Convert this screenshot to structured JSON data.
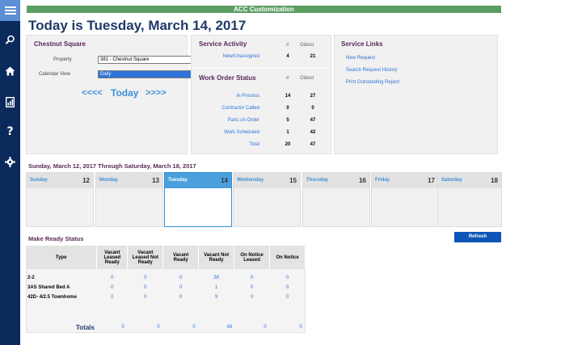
{
  "app": {
    "banner": "ACC Customization"
  },
  "page": {
    "title": "Today is Tuesday, March 14, 2017"
  },
  "sidebar": {
    "icons": [
      "menu-icon",
      "search-icon",
      "home-icon",
      "report-icon",
      "help-icon",
      "settings-icon"
    ]
  },
  "property_panel": {
    "title": "Chestnut Square",
    "property_label": "Property",
    "property_value": "381 - Chestnut Square",
    "calendar_label": "Calendar View",
    "calendar_value": "Daily",
    "prev": "<<<<",
    "today": "Today",
    "next": ">>>>"
  },
  "service_activity": {
    "title": "Service Activity",
    "col_count": "#",
    "col_oldest": "Oldest",
    "rows": [
      {
        "label": "New/Unassigned",
        "count": "4",
        "oldest": "21"
      }
    ]
  },
  "work_order_status": {
    "title": "Work Order Status",
    "col_count": "#",
    "col_oldest": "Oldest",
    "rows": [
      {
        "label": "In Process",
        "count": "14",
        "oldest": "27"
      },
      {
        "label": "Contractor Called",
        "count": "0",
        "oldest": "0"
      },
      {
        "label": "Parts on Order",
        "count": "5",
        "oldest": "47"
      },
      {
        "label": "Work Scheduled",
        "count": "1",
        "oldest": "42"
      },
      {
        "label": "Total",
        "count": "20",
        "oldest": "47"
      }
    ]
  },
  "service_links": {
    "title": "Service Links",
    "links": [
      "New Request",
      "Search Request History",
      "Print Outstanding Report"
    ]
  },
  "week": {
    "title": "Sunday, March 12, 2017 Through Saturday, March 18, 2017",
    "days": [
      {
        "name": "Sunday",
        "num": "12"
      },
      {
        "name": "Monday",
        "num": "13"
      },
      {
        "name": "Tuesday",
        "num": "14"
      },
      {
        "name": "Wednesday",
        "num": "15"
      },
      {
        "name": "Thursday",
        "num": "16"
      },
      {
        "name": "Friday",
        "num": "17"
      },
      {
        "name": "Saturday",
        "num": "18"
      }
    ],
    "today_index": 2
  },
  "make_ready": {
    "title": "Make Ready Status",
    "refresh_label": "Refresh",
    "columns": [
      "Type",
      "Vacant Leased Ready",
      "Vacant Leased Not Ready",
      "Vacant Ready",
      "Vacant Not Ready",
      "On Notice Leased",
      "On Notice"
    ],
    "rows": [
      {
        "type": "2-2",
        "values": [
          "0",
          "0",
          "0",
          "38",
          "0",
          "0"
        ]
      },
      {
        "type": "3AS Shared Bed A",
        "values": [
          "0",
          "0",
          "0",
          "1",
          "0",
          "0"
        ]
      },
      {
        "type": "42D- 4/2.5 Townhome",
        "values": [
          "0",
          "0",
          "0",
          "9",
          "0",
          "0"
        ]
      }
    ],
    "totals_label": "Totals",
    "totals": [
      "0",
      "0",
      "0",
      "48",
      "0",
      "0"
    ]
  },
  "colors": {
    "sidebar": "#0a2a5c",
    "banner": "#5a9e62",
    "accent": "#2f73d8",
    "title": "#1f3a68",
    "section_title": "#5a2a5a"
  }
}
